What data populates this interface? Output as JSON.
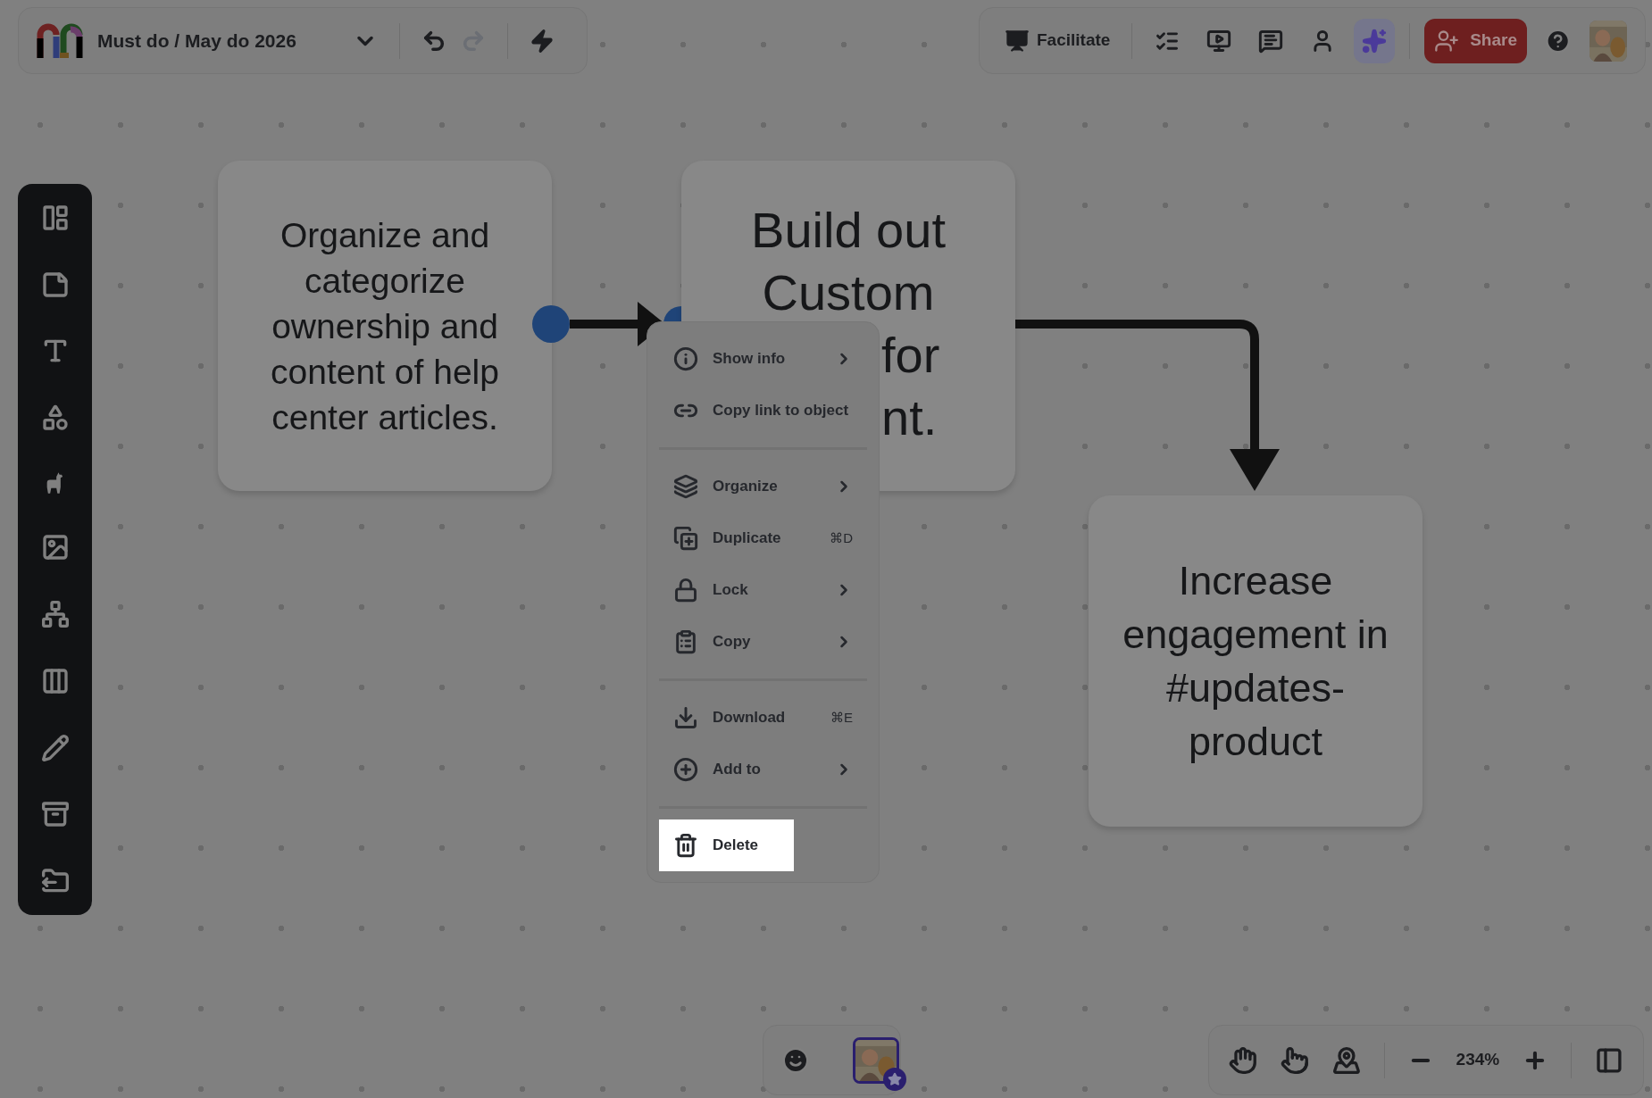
{
  "header": {
    "title": "Must do / May do 2026"
  },
  "top_bar": {
    "facilitate": "Facilitate",
    "share": "Share",
    "tools": [
      {
        "selected": false
      },
      {
        "selected": false
      },
      {
        "selected": false
      },
      {
        "selected": false
      },
      {
        "selected": true
      }
    ]
  },
  "cards": [
    {
      "text": "Organize and categorize ownership and content of help center articles."
    },
    {
      "lines": [
        "Build out",
        "Custom",
        "for",
        "nt."
      ]
    },
    {
      "text": "Increase engagement in #updates-product"
    }
  ],
  "context_menu": {
    "groups": [
      [
        {
          "label": "Show info",
          "submenu": true,
          "selected": false
        },
        {
          "label": "Copy link to object",
          "submenu": false,
          "selected": false
        }
      ],
      [
        {
          "label": "Organize",
          "submenu": true,
          "selected": false
        },
        {
          "label": "Duplicate",
          "shortcut": "⌘D",
          "submenu": false,
          "selected": false
        },
        {
          "label": "Lock",
          "submenu": true,
          "selected": false
        },
        {
          "label": "Copy",
          "submenu": true,
          "selected": false
        }
      ],
      [
        {
          "label": "Download",
          "shortcut": "⌘E",
          "submenu": false,
          "selected": false
        },
        {
          "label": "Add to",
          "submenu": true,
          "selected": false
        }
      ],
      [
        {
          "label": "Delete",
          "submenu": false,
          "selected": true
        }
      ]
    ]
  },
  "zoom": {
    "value": "234%"
  }
}
